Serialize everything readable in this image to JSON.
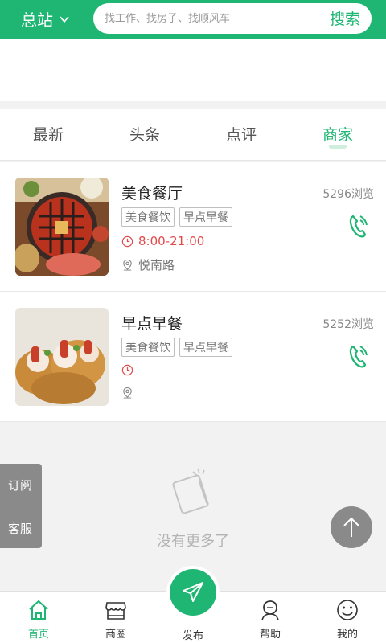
{
  "header": {
    "city": "总站",
    "search_placeholder": "找工作、找房子、找顺风车",
    "search_button": "搜索"
  },
  "tabs": [
    {
      "label": "最新",
      "active": false
    },
    {
      "label": "头条",
      "active": false
    },
    {
      "label": "点评",
      "active": false
    },
    {
      "label": "商家",
      "active": true
    }
  ],
  "shops": [
    {
      "name": "美食餐厅",
      "views": "5296浏览",
      "tags": [
        "美食餐饮",
        "早点早餐"
      ],
      "hours": "8:00-21:00",
      "address": "悦南路",
      "image_icon": "hotpot-photo"
    },
    {
      "name": "早点早餐",
      "views": "5252浏览",
      "tags": [
        "美食餐饮",
        "早点早餐"
      ],
      "hours": "",
      "address": "",
      "image_icon": "shrimp-tart-photo"
    }
  ],
  "empty": {
    "text": "没有更多了",
    "icon": "empty-note-icon"
  },
  "side_tab": {
    "subscribe": "订阅",
    "service": "客服"
  },
  "bottom_nav": {
    "items": [
      {
        "label": "首页",
        "icon": "home-icon",
        "active": true
      },
      {
        "label": "商圈",
        "icon": "store-icon",
        "active": false
      },
      {
        "label": "发布",
        "icon": "send-icon",
        "active": false
      },
      {
        "label": "帮助",
        "icon": "help-icon",
        "active": false
      },
      {
        "label": "我的",
        "icon": "smile-icon",
        "active": false
      }
    ]
  },
  "colors": {
    "brand": "#1fb573",
    "hours_red": "#e24a4a",
    "gray_button": "#8a8a8a"
  }
}
